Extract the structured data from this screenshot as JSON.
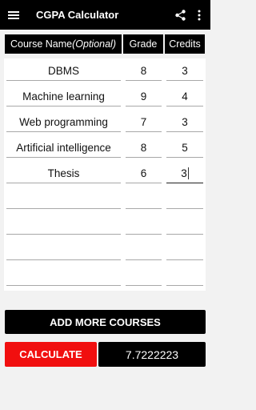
{
  "app": {
    "title": "CGPA Calculator",
    "icons": [
      "menu-icon",
      "share-icon",
      "more-vertical-icon"
    ]
  },
  "table": {
    "headers": {
      "course_name": "Course Name",
      "course_name_suffix": "(Optional)",
      "grade": "Grade",
      "credits": "Credits"
    },
    "rows": [
      {
        "name": "DBMS",
        "grade": "8",
        "credits": "3"
      },
      {
        "name": "Machine learning",
        "grade": "9",
        "credits": "4"
      },
      {
        "name": "Web programming",
        "grade": "7",
        "credits": "3"
      },
      {
        "name": "Artificial intelligence",
        "grade": "8",
        "credits": "5"
      },
      {
        "name": "Thesis",
        "grade": "6",
        "credits": "3"
      },
      {
        "name": "",
        "grade": "",
        "credits": ""
      },
      {
        "name": "",
        "grade": "",
        "credits": ""
      },
      {
        "name": "",
        "grade": "",
        "credits": ""
      },
      {
        "name": "",
        "grade": "",
        "credits": ""
      }
    ]
  },
  "actions": {
    "add_more": "ADD MORE COURSES",
    "calculate": "CALCULATE",
    "result": "7.7222223"
  },
  "colors": {
    "appbar": "#000000",
    "calculate": "#f10f0f",
    "background": "#f2f2f2"
  }
}
